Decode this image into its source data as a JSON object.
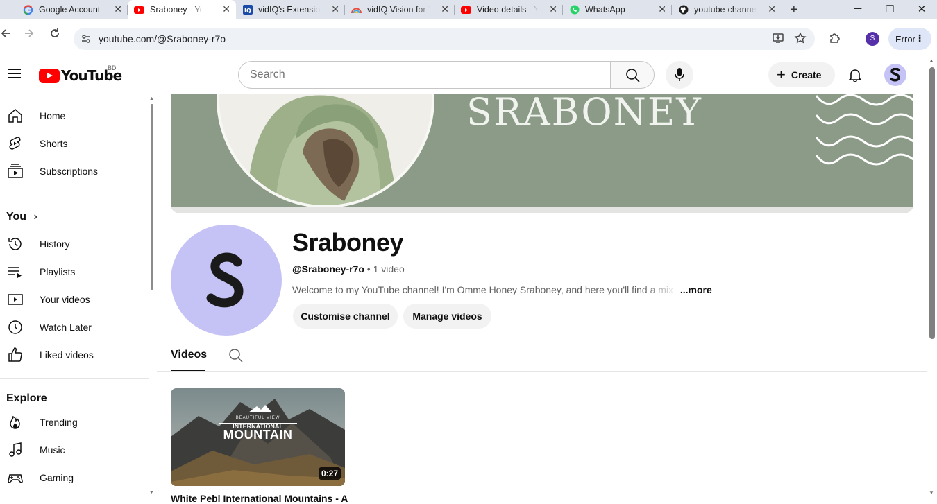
{
  "browser": {
    "tabs": [
      {
        "title": "Google Account",
        "icon": "google-icon"
      },
      {
        "title": "Sraboney - YouTube",
        "icon": "youtube-icon",
        "active": true
      },
      {
        "title": "vidIQ's Extension",
        "icon": "vidiq-icon"
      },
      {
        "title": "vidIQ Vision for YouTube",
        "icon": "vidiq-vision-icon"
      },
      {
        "title": "Video details - YouTube Studio",
        "icon": "youtube-icon"
      },
      {
        "title": "WhatsApp",
        "icon": "whatsapp-icon"
      },
      {
        "title": "youtube-channel",
        "icon": "github-icon"
      }
    ],
    "url": "youtube.com/@Sraboney-r7o",
    "profile_initial": "S",
    "error_label": "Error"
  },
  "header": {
    "logo_text": "YouTube",
    "country_code": "BD",
    "search_placeholder": "Search",
    "create_label": "Create"
  },
  "sidebar": {
    "main": [
      {
        "label": "Home",
        "icon": "home-icon"
      },
      {
        "label": "Shorts",
        "icon": "shorts-icon"
      },
      {
        "label": "Subscriptions",
        "icon": "subscriptions-icon"
      }
    ],
    "you_heading": "You",
    "you": [
      {
        "label": "History",
        "icon": "history-icon"
      },
      {
        "label": "Playlists",
        "icon": "playlists-icon"
      },
      {
        "label": "Your videos",
        "icon": "your-videos-icon"
      },
      {
        "label": "Watch Later",
        "icon": "watch-later-icon"
      },
      {
        "label": "Liked videos",
        "icon": "liked-videos-icon"
      }
    ],
    "explore_heading": "Explore",
    "explore": [
      {
        "label": "Trending",
        "icon": "trending-icon"
      },
      {
        "label": "Music",
        "icon": "music-icon"
      },
      {
        "label": "Gaming",
        "icon": "gaming-icon"
      }
    ]
  },
  "channel": {
    "banner_text": "SRABONEY",
    "name": "Sraboney",
    "handle": "@Sraboney-r7o",
    "video_count": "1 video",
    "description": "Welcome to my YouTube channel! I'm Omme Honey Sraboney, and here you'll find a mix of",
    "more_label": "...more",
    "customise_label": "Customise channel",
    "manage_label": "Manage videos",
    "tab_videos": "Videos"
  },
  "video": {
    "thumb_line1": "BEAUTIFUL VIEW",
    "thumb_line2": "INTERNATIONAL",
    "thumb_line3": "MOUNTAIN",
    "duration": "0:27",
    "title": "White Pebl International Mountains - A"
  }
}
